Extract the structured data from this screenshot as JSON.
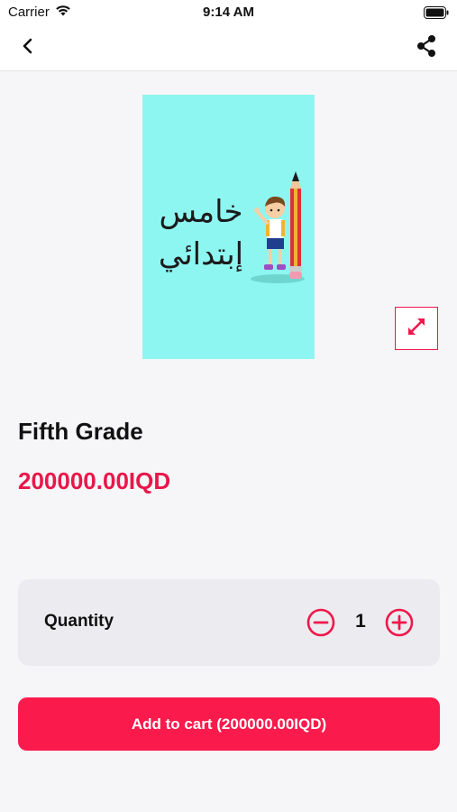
{
  "status_bar": {
    "carrier": "Carrier",
    "time": "9:14 AM",
    "icons": [
      "wifi-icon",
      "battery-icon"
    ]
  },
  "nav": {
    "back_icon": "chevron-left-icon",
    "share_icon": "share-icon"
  },
  "product": {
    "cover_text_line1": "خامس",
    "cover_text_line2": "إبتدائي",
    "cover_background": "#8ef6f1",
    "title": "Fifth Grade",
    "price": "200000.00IQD",
    "expand_icon": "expand-arrows-icon"
  },
  "quantity": {
    "label": "Quantity",
    "value": "1",
    "minus_icon": "minus-circle-icon",
    "plus_icon": "plus-circle-icon"
  },
  "cart": {
    "button_label": "Add to cart (200000.00IQD)"
  },
  "colors": {
    "accent": "#f0174b",
    "button": "#fb1a4c",
    "background": "#f6f6f8",
    "card": "#ececf0"
  }
}
